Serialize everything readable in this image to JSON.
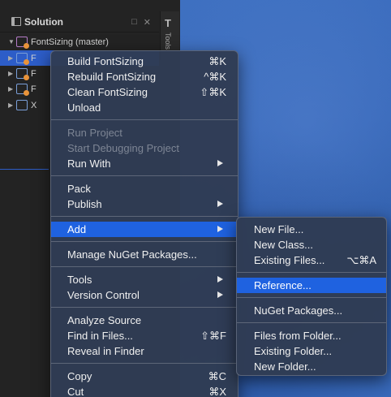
{
  "solution_pane": {
    "title": "Solution",
    "controls": [
      "□",
      "✕"
    ],
    "side_tab_icon": "T",
    "side_tab_label": "Tools",
    "tree": [
      {
        "label": "FontSizing (master)",
        "kind": "solution",
        "twist": "▼"
      },
      {
        "label": "F",
        "kind": "project",
        "twist": "▶",
        "selected": true
      },
      {
        "label": "F",
        "kind": "project",
        "twist": "▶"
      },
      {
        "label": "F",
        "kind": "project",
        "twist": "▶"
      },
      {
        "label": "X",
        "kind": "project-plain",
        "twist": "▶"
      }
    ]
  },
  "context_menu": {
    "build": {
      "label": "Build FontSizing",
      "shortcut": "⌘K"
    },
    "rebuild": {
      "label": "Rebuild FontSizing",
      "shortcut": "^⌘K"
    },
    "clean": {
      "label": "Clean FontSizing",
      "shortcut": "⇧⌘K"
    },
    "unload": {
      "label": "Unload"
    },
    "run_project": {
      "label": "Run Project"
    },
    "start_debugging": {
      "label": "Start Debugging Project"
    },
    "run_with": {
      "label": "Run With"
    },
    "pack": {
      "label": "Pack"
    },
    "publish": {
      "label": "Publish"
    },
    "add": {
      "label": "Add"
    },
    "manage_nuget": {
      "label": "Manage NuGet Packages..."
    },
    "tools": {
      "label": "Tools"
    },
    "version_control": {
      "label": "Version Control"
    },
    "analyze_source": {
      "label": "Analyze Source"
    },
    "find_in_files": {
      "label": "Find in Files...",
      "shortcut": "⇧⌘F"
    },
    "reveal_in_finder": {
      "label": "Reveal in Finder"
    },
    "copy": {
      "label": "Copy",
      "shortcut": "⌘C"
    },
    "cut": {
      "label": "Cut",
      "shortcut": "⌘X"
    }
  },
  "add_submenu": {
    "new_file": {
      "label": "New File..."
    },
    "new_class": {
      "label": "New Class..."
    },
    "existing_files": {
      "label": "Existing Files...",
      "shortcut": "⌥⌘A"
    },
    "reference": {
      "label": "Reference..."
    },
    "nuget_packages": {
      "label": "NuGet Packages..."
    },
    "files_from_folder": {
      "label": "Files from Folder..."
    },
    "existing_folder": {
      "label": "Existing Folder..."
    },
    "new_folder": {
      "label": "New Folder..."
    }
  },
  "colors": {
    "menu_bg": "#303c54",
    "highlight": "#1f62e0",
    "selection": "#2d5dc8",
    "desktop": "#3566b8"
  }
}
